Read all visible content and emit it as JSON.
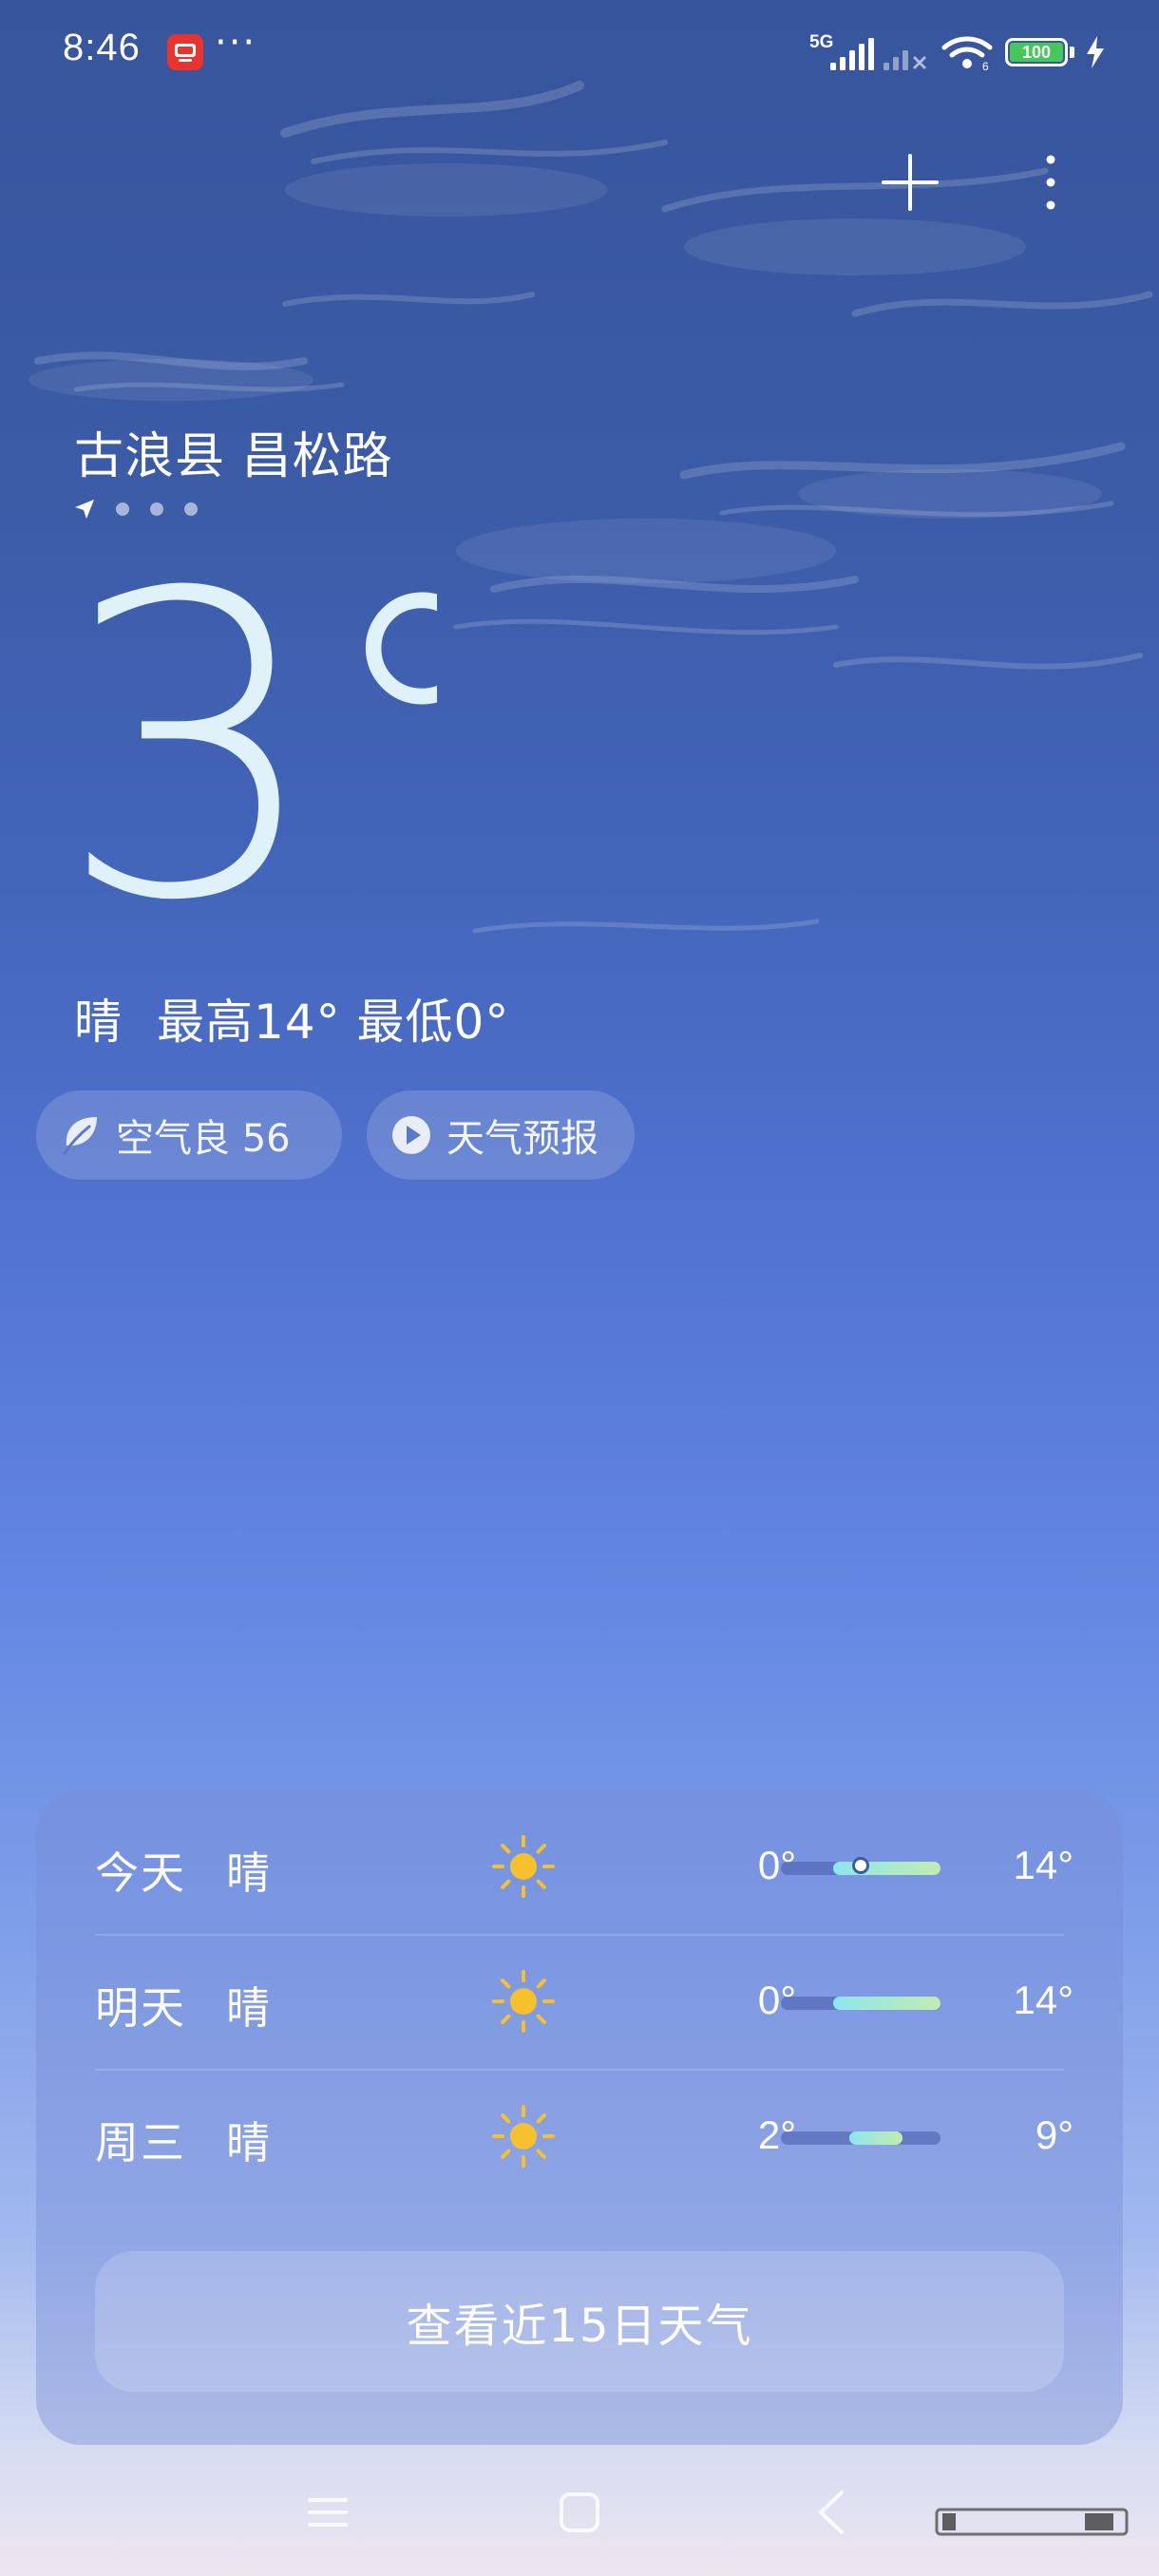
{
  "status_bar": {
    "time": "8:46",
    "more": "···",
    "network": "5G",
    "battery": "100"
  },
  "location": {
    "name": "古浪县 昌松路",
    "page_count": 4,
    "current_page": 1
  },
  "current": {
    "temperature": "3°",
    "condition": "晴",
    "high_low": "最高14° 最低0°"
  },
  "chips": {
    "air_quality": "空气良 56",
    "forecast_video": "天气预报"
  },
  "forecast": [
    {
      "day": "今天",
      "condition": "晴",
      "icon": "sun-icon",
      "low": "0°",
      "high": "14°",
      "range_start": 0.33,
      "range_end": 1.0,
      "current_marker": 0.5
    },
    {
      "day": "明天",
      "condition": "晴",
      "icon": "sun-icon",
      "low": "0°",
      "high": "14°",
      "range_start": 0.33,
      "range_end": 1.0
    },
    {
      "day": "周三",
      "condition": "晴",
      "icon": "sun-icon",
      "low": "2°",
      "high": "9°",
      "range_start": 0.43,
      "range_end": 0.76
    }
  ],
  "view_15_days": "查看近15日天气",
  "colors": {
    "sun": "#f7c12e",
    "battery": "#45c75a",
    "temp_bar_fill": "#8ee6ee"
  }
}
